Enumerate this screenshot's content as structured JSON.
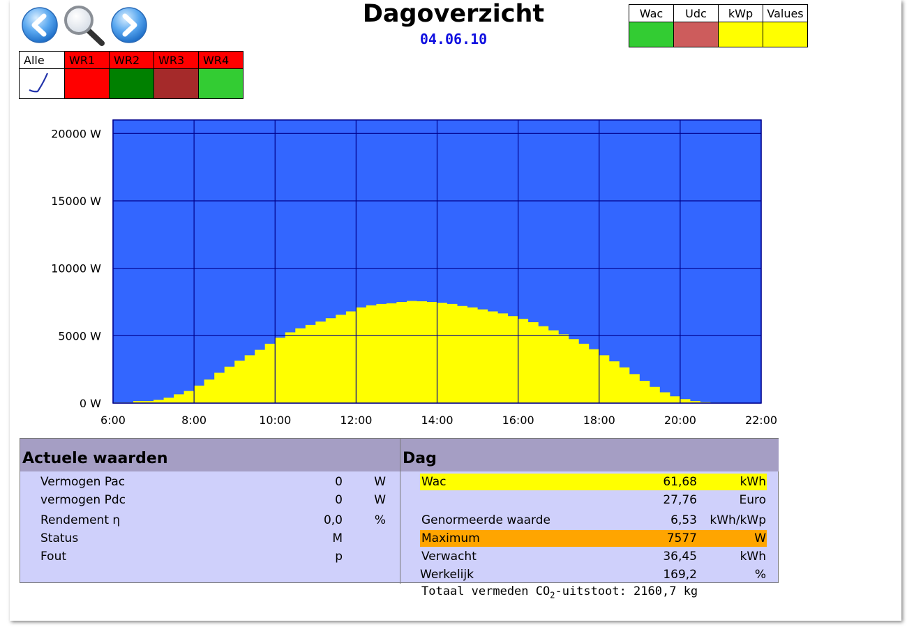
{
  "header": {
    "title": "Dagoverzicht",
    "date": "04.06.10"
  },
  "nav": {
    "back_icon": "arrow-left-icon",
    "search_icon": "magnifier-icon",
    "forward_icon": "arrow-right-icon"
  },
  "inverters": [
    {
      "label": "Alle",
      "label_color": "#ffffff",
      "swatch": "#ffffff",
      "selected": true
    },
    {
      "label": "WR1",
      "label_color": "#ff0000",
      "swatch": "#ff0000"
    },
    {
      "label": "WR2",
      "label_color": "#ff0000",
      "swatch": "#008000"
    },
    {
      "label": "WR3",
      "label_color": "#ff0000",
      "swatch": "#a52a2a"
    },
    {
      "label": "WR4",
      "label_color": "#ff0000",
      "swatch": "#33cc33"
    }
  ],
  "legend": [
    {
      "label": "Wac",
      "color": "#33cc33"
    },
    {
      "label": "Udc",
      "color": "#cd5c5c"
    },
    {
      "label": "kWp",
      "color": "#ffff00"
    },
    {
      "label": "Values",
      "color": "#ffff00"
    }
  ],
  "chart_data": {
    "type": "area",
    "x_tick_labels": [
      "6:00",
      "8:00",
      "10:00",
      "12:00",
      "14:00",
      "16:00",
      "18:00",
      "20:00",
      "22:00"
    ],
    "y_tick_labels": [
      "0 W",
      "5000 W",
      "10000 W",
      "15000 W",
      "20000 W"
    ],
    "xlim_hours": [
      6,
      22
    ],
    "ylim": [
      0,
      21000
    ],
    "y_ticks": [
      0,
      5000,
      10000,
      15000,
      20000
    ],
    "grid": true,
    "background_color": "#3366ff",
    "fill_color": "#ffff00",
    "grid_color": "#00008b",
    "series": [
      {
        "x_hours": [
          6.0,
          6.5,
          7.0,
          7.25,
          7.5,
          7.75,
          8.0,
          8.25,
          8.5,
          8.75,
          9.0,
          9.25,
          9.5,
          9.75,
          10.0,
          10.25,
          10.5,
          10.75,
          11.0,
          11.25,
          11.5,
          11.75,
          12.0,
          12.25,
          12.5,
          12.75,
          13.0,
          13.25,
          13.5,
          13.75,
          14.0,
          14.25,
          14.5,
          14.75,
          15.0,
          15.25,
          15.5,
          15.75,
          16.0,
          16.25,
          16.5,
          16.75,
          17.0,
          17.25,
          17.5,
          17.75,
          18.0,
          18.25,
          18.5,
          18.75,
          19.0,
          19.25,
          19.5,
          19.75,
          20.0,
          20.25,
          20.5,
          20.75,
          21.0,
          21.25,
          21.33
        ],
        "values": [
          50,
          150,
          250,
          400,
          650,
          900,
          1300,
          1750,
          2250,
          2700,
          3150,
          3550,
          3950,
          4400,
          4850,
          5250,
          5550,
          5800,
          6050,
          6300,
          6550,
          6800,
          7100,
          7250,
          7350,
          7400,
          7500,
          7577,
          7550,
          7500,
          7450,
          7350,
          7200,
          7100,
          6950,
          6800,
          6650,
          6450,
          6250,
          6000,
          5700,
          5400,
          5100,
          4750,
          4400,
          4000,
          3550,
          3100,
          2650,
          2150,
          1650,
          1200,
          800,
          500,
          300,
          150,
          80,
          40,
          20,
          10,
          0
        ]
      }
    ]
  },
  "actual": {
    "title": "Actuele waarden",
    "rows": [
      {
        "label": "Vermogen Pac",
        "value": "0",
        "unit": "W"
      },
      {
        "label": "vermogen Pdc",
        "value": "0",
        "unit": "W"
      },
      {
        "label": "Rendement η",
        "value": "0,0",
        "unit": "%"
      },
      {
        "label": "Status",
        "value": "M",
        "unit": ""
      },
      {
        "label": "Fout",
        "value": "p",
        "unit": ""
      }
    ]
  },
  "day": {
    "title": "Dag",
    "rows": [
      {
        "label": "Wac",
        "value": "61,68",
        "unit": "kWh",
        "highlight": "#ffff00"
      },
      {
        "label": "",
        "value": "27,76",
        "unit": "Euro"
      },
      {
        "label": "Genormeerde waarde",
        "value": "6,53",
        "unit": "kWh/kWp"
      },
      {
        "label": "Maximum",
        "value": "7577",
        "unit": "W",
        "highlight": "#ffa500"
      },
      {
        "label": "Verwacht",
        "value": "36,45",
        "unit": "kWh"
      },
      {
        "label": "Werkelijk",
        "value": "169,2",
        "unit": "%"
      }
    ]
  },
  "co2": {
    "prefix": "Totaal vermeden CO",
    "sub": "2",
    "suffix": "-uitstoot: 2160,7 kg"
  }
}
